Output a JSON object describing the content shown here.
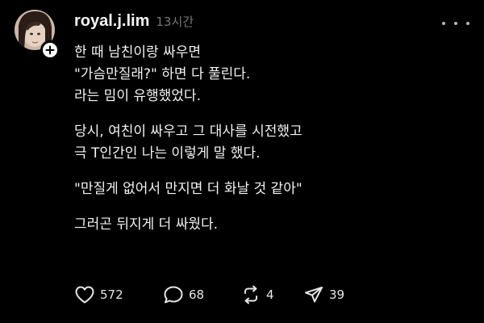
{
  "post": {
    "author": "royal.j.lim",
    "time": "13시간",
    "paragraphs": [
      "한 때 남친이랑 싸우면\n\"가슴만질래?\" 하면 다 풀린다.\n라는 밈이 유행했었다.",
      "당시, 여친이 싸우고 그 대사를 시전했고\n극 T인간인 나는 이렇게 말 했다.",
      "\"만질게 없어서 만지면 더 화날 것 같아\"",
      "그러곤 뒤지게 더 싸웠다."
    ]
  },
  "actions": {
    "likes": "572",
    "comments": "68",
    "reposts": "4",
    "shares": "39"
  },
  "icons": {
    "follow": "plus-icon",
    "more": "more-horizontal-icon",
    "like": "heart-icon",
    "comment": "comment-bubble-icon",
    "repost": "repost-icon",
    "share": "send-icon"
  },
  "colors": {
    "background": "#000000",
    "text": "#f3f3f3",
    "muted": "#777777"
  }
}
